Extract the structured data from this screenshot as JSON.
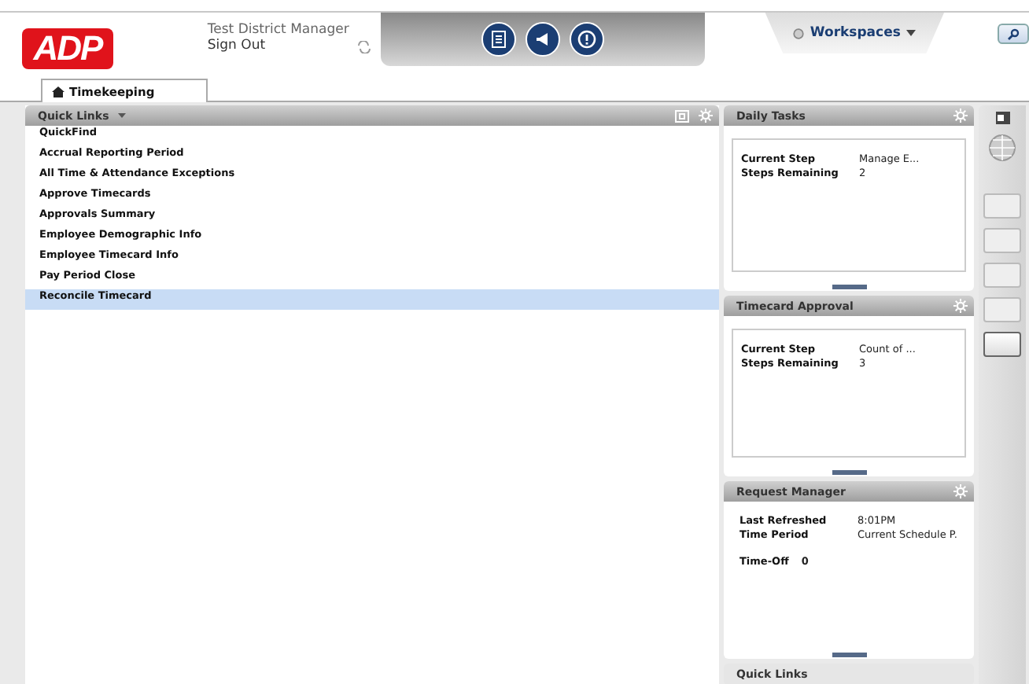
{
  "header": {
    "logo": "ADP",
    "user": "Test District Manager",
    "sign_out": "Sign Out",
    "workspaces": "Workspaces"
  },
  "tabs": [
    {
      "label": "Timekeeping",
      "selected": true
    }
  ],
  "quick_links": {
    "title": "Quick Links",
    "items": [
      {
        "label": "QuickFind",
        "selected": false
      },
      {
        "label": "Accrual Reporting Period",
        "selected": false
      },
      {
        "label": "All Time & Attendance Exceptions",
        "selected": false
      },
      {
        "label": "Approve Timecards",
        "selected": false
      },
      {
        "label": "Approvals Summary",
        "selected": false
      },
      {
        "label": "Employee Demographic Info",
        "selected": false
      },
      {
        "label": "Employee Timecard Info",
        "selected": false
      },
      {
        "label": "Pay Period Close",
        "selected": false
      },
      {
        "label": "Reconcile Timecard",
        "selected": true
      }
    ]
  },
  "widgets": [
    {
      "title": "Daily Tasks",
      "framed": true,
      "rows": [
        {
          "label": "Current Step",
          "value": "Manage E..."
        },
        {
          "label": "Steps Remaining",
          "value": "2"
        }
      ]
    },
    {
      "title": "Timecard Approval",
      "framed": true,
      "rows": [
        {
          "label": "Current Step",
          "value": "Count of ..."
        },
        {
          "label": "Steps Remaining",
          "value": "3"
        }
      ]
    },
    {
      "title": "Request Manager",
      "framed": false,
      "rows": [
        {
          "label": "Last Refreshed",
          "value": "8:01PM"
        },
        {
          "label": "Time Period",
          "value": "Current Schedule P."
        }
      ],
      "summary": {
        "label": "Time-Off",
        "value": "0"
      }
    }
  ],
  "bottom_widget": {
    "title": "Quick Links"
  },
  "rail": [
    {
      "selected": false
    },
    {
      "selected": false
    },
    {
      "selected": false
    },
    {
      "selected": false
    },
    {
      "selected": true
    }
  ]
}
